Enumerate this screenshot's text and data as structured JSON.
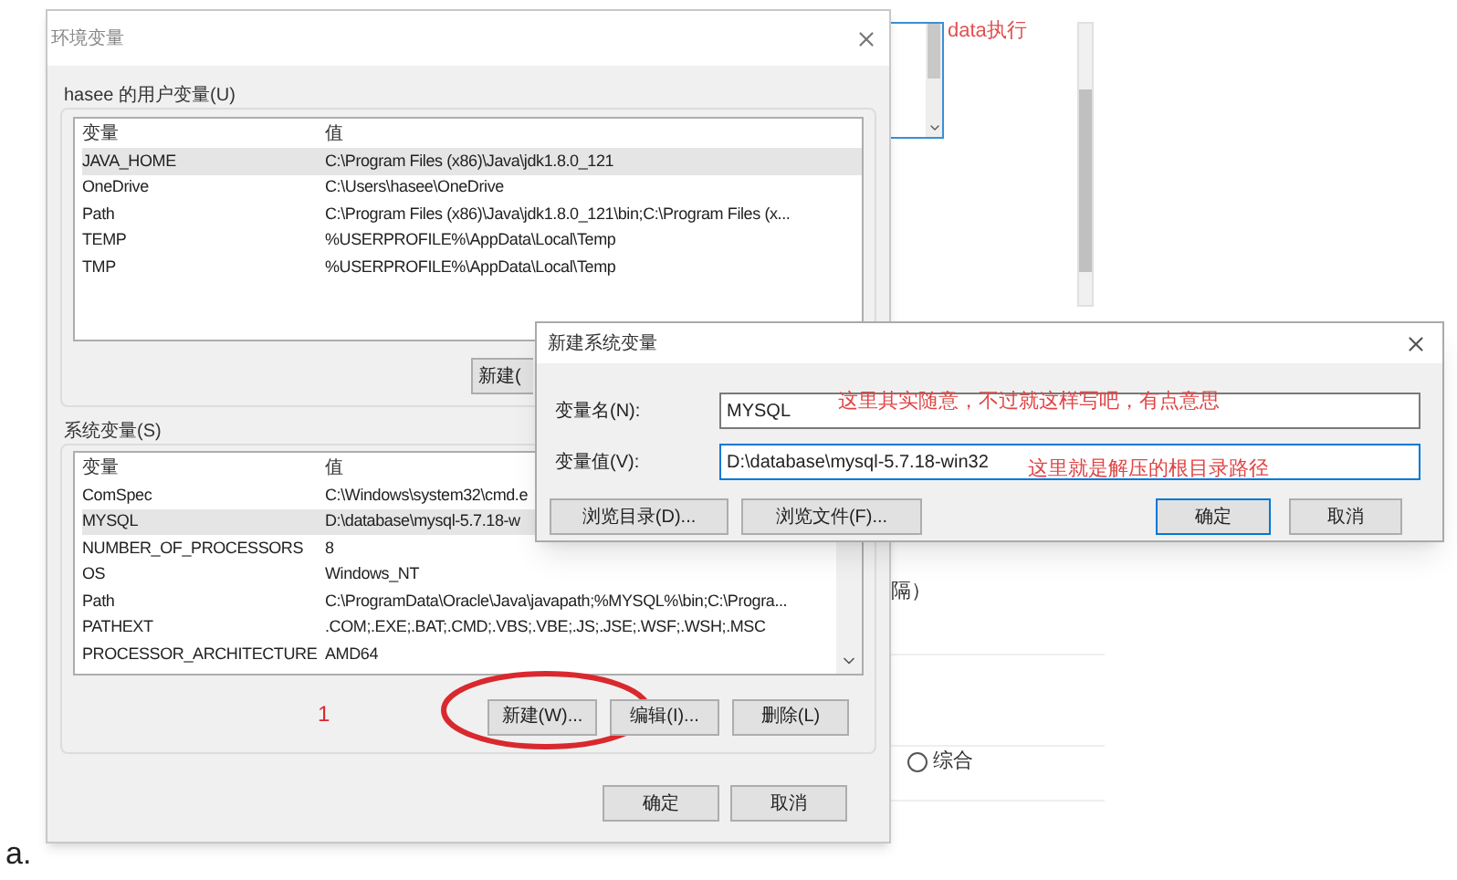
{
  "background_page": {
    "top_text": "data执行",
    "fragment_text": "隔）",
    "radio": {
      "label": "综合",
      "selected": false
    },
    "footnote": "a."
  },
  "env_dialog": {
    "title": "环境变量",
    "user_group": {
      "label": "hasee 的用户变量(U)",
      "columns": [
        "变量",
        "值"
      ],
      "rows": [
        {
          "name": "JAVA_HOME",
          "value": "C:\\Program Files (x86)\\Java\\jdk1.8.0_121",
          "selected": true
        },
        {
          "name": "OneDrive",
          "value": "C:\\Users\\hasee\\OneDrive",
          "selected": false
        },
        {
          "name": "Path",
          "value": "C:\\Program Files (x86)\\Java\\jdk1.8.0_121\\bin;C:\\Program Files (x...",
          "selected": false
        },
        {
          "name": "TEMP",
          "value": "%USERPROFILE%\\AppData\\Local\\Temp",
          "selected": false
        },
        {
          "name": "TMP",
          "value": "%USERPROFILE%\\AppData\\Local\\Temp",
          "selected": false
        }
      ],
      "buttons": [
        "新建("
      ]
    },
    "system_group": {
      "label": "系统变量(S)",
      "columns": [
        "变量",
        "值"
      ],
      "rows": [
        {
          "name": "ComSpec",
          "value": "C:\\Windows\\system32\\cmd.e",
          "selected": false
        },
        {
          "name": "MYSQL",
          "value": "D:\\database\\mysql-5.7.18-w",
          "selected": true
        },
        {
          "name": "NUMBER_OF_PROCESSORS",
          "value": "8",
          "selected": false
        },
        {
          "name": "OS",
          "value": "Windows_NT",
          "selected": false
        },
        {
          "name": "Path",
          "value": "C:\\ProgramData\\Oracle\\Java\\javapath;%MYSQL%\\bin;C:\\Progra...",
          "selected": false
        },
        {
          "name": "PATHEXT",
          "value": ".COM;.EXE;.BAT;.CMD;.VBS;.VBE;.JS;.JSE;.WSF;.WSH;.MSC",
          "selected": false
        },
        {
          "name": "PROCESSOR_ARCHITECTURE",
          "value": "AMD64",
          "selected": false
        }
      ],
      "annotation": "1",
      "buttons": [
        {
          "label": "新建(W)...",
          "circled": true
        },
        {
          "label": "编辑(I)...",
          "circled": false
        },
        {
          "label": "删除(L)",
          "circled": false
        }
      ]
    },
    "buttons": [
      "确定",
      "取消"
    ]
  },
  "new_var_dialog": {
    "title": "新建系统变量",
    "fields": [
      {
        "label": "变量名(N):",
        "value": "MYSQL",
        "focused": false,
        "annotation": "这里其实随意，不过就这样写吧，有点意思"
      },
      {
        "label": "变量值(V):",
        "value": "D:\\database\\mysql-5.7.18-win32",
        "focused": true,
        "annotation": "这里就是解压的根目录路径"
      }
    ],
    "buttons": [
      {
        "label": "浏览目录(D)...",
        "default": false
      },
      {
        "label": "浏览文件(F)...",
        "default": false
      },
      {
        "label": "确定",
        "default": true
      },
      {
        "label": "取消",
        "default": false
      }
    ]
  }
}
